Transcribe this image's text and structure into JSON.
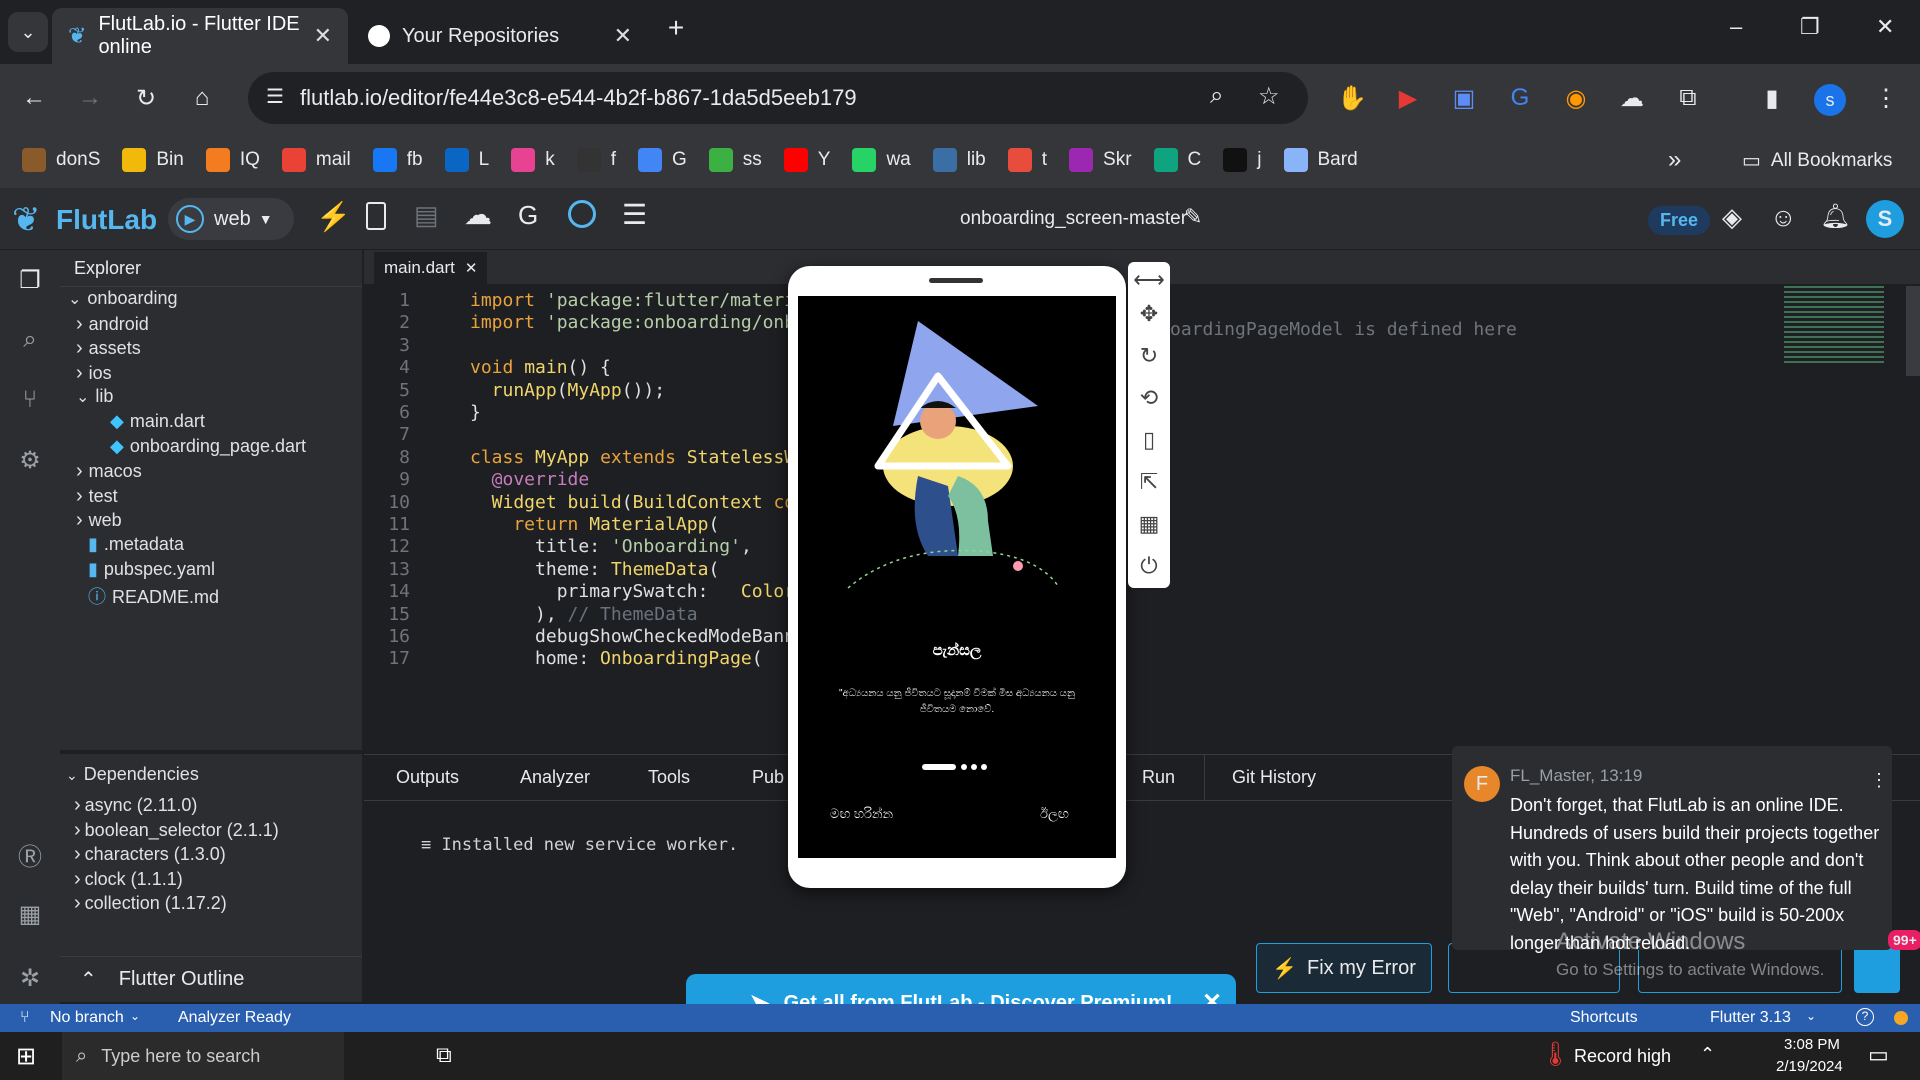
{
  "browser": {
    "tabs": [
      {
        "title": "FlutLab.io - Flutter IDE online",
        "active": true
      },
      {
        "title": "Your Repositories",
        "active": false
      }
    ],
    "new_tab": "+",
    "url": "flutlab.io/editor/fe44e3c8-e544-4b2f-b867-1da5d5eeb179",
    "profile_initial": "s",
    "window_controls": {
      "minimize": "–",
      "restore": "❐",
      "close": "✕"
    },
    "bookmarks": [
      {
        "label": "donS",
        "color": "#8b5a2b"
      },
      {
        "label": "Bin",
        "color": "#f0b90b"
      },
      {
        "label": "IQ",
        "color": "#f47c20"
      },
      {
        "label": "mail",
        "color": "#ea4335"
      },
      {
        "label": "fb",
        "color": "#1877f2"
      },
      {
        "label": "L",
        "color": "#0a66c2"
      },
      {
        "label": "k",
        "color": "#e84393"
      },
      {
        "label": "f",
        "color": "#333333"
      },
      {
        "label": "G",
        "color": "#4285f4"
      },
      {
        "label": "ss",
        "color": "#3cb043"
      },
      {
        "label": "Y",
        "color": "#ff0000"
      },
      {
        "label": "wa",
        "color": "#25d366"
      },
      {
        "label": "lib",
        "color": "#3b6ea5"
      },
      {
        "label": "t",
        "color": "#e84c3d"
      },
      {
        "label": "Skr",
        "color": "#9c27b0"
      },
      {
        "label": "C",
        "color": "#10a37f"
      },
      {
        "label": "j",
        "color": "#111111"
      },
      {
        "label": "Bard",
        "color": "#8ab4f8"
      }
    ],
    "more": "»",
    "all_bookmarks": "All Bookmarks"
  },
  "ide": {
    "logo": "FlutLab",
    "platform": "web",
    "project_name": "onboarding_screen-master",
    "plan_badge": "Free",
    "user_initial": "S",
    "explorer_title": "Explorer",
    "tree": [
      {
        "label": "onboarding",
        "type": "folder-open",
        "indent": 0
      },
      {
        "label": "android",
        "type": "folder",
        "indent": 1
      },
      {
        "label": "assets",
        "type": "folder",
        "indent": 1
      },
      {
        "label": "ios",
        "type": "folder",
        "indent": 1
      },
      {
        "label": "lib",
        "type": "folder-open",
        "indent": 1
      },
      {
        "label": "main.dart",
        "type": "dart",
        "indent": 2
      },
      {
        "label": "onboarding_page.dart",
        "type": "dart",
        "indent": 2
      },
      {
        "label": "macos",
        "type": "folder",
        "indent": 1
      },
      {
        "label": "test",
        "type": "folder",
        "indent": 1
      },
      {
        "label": "web",
        "type": "folder",
        "indent": 1
      },
      {
        "label": ".metadata",
        "type": "file",
        "indent": 1
      },
      {
        "label": "pubspec.yaml",
        "type": "file",
        "indent": 1
      },
      {
        "label": "README.md",
        "type": "info",
        "indent": 1
      }
    ],
    "dependencies_title": "Dependencies",
    "dependencies": [
      "async (2.11.0)",
      "boolean_selector (2.1.1)",
      "characters (1.3.0)",
      "clock (1.1.1)",
      "collection (1.17.2)"
    ],
    "flutter_outline": "Flutter Outline",
    "open_tab": "main.dart",
    "code_lines": [
      [
        {
          "t": "import ",
          "c": "kw"
        },
        {
          "t": "'package:flutter/materia",
          "c": "str"
        }
      ],
      [
        {
          "t": "import ",
          "c": "kw"
        },
        {
          "t": "'package:onboarding/onbo",
          "c": "str"
        }
      ],
      [],
      [
        {
          "t": "void ",
          "c": "kw"
        },
        {
          "t": "main",
          "c": "fn"
        },
        {
          "t": "() {",
          "c": "p"
        }
      ],
      [
        {
          "t": "  runApp",
          "c": "fn"
        },
        {
          "t": "(",
          "c": "p"
        },
        {
          "t": "MyApp",
          "c": "cls"
        },
        {
          "t": "());",
          "c": "p"
        }
      ],
      [
        {
          "t": "}",
          "c": "p"
        }
      ],
      [],
      [
        {
          "t": "class ",
          "c": "kw"
        },
        {
          "t": "MyApp ",
          "c": "cls"
        },
        {
          "t": "extends ",
          "c": "kw"
        },
        {
          "t": "StatelessWi",
          "c": "cls"
        }
      ],
      [
        {
          "t": "  @override",
          "c": "ann"
        }
      ],
      [
        {
          "t": "  Widget ",
          "c": "cls"
        },
        {
          "t": "build",
          "c": "fn"
        },
        {
          "t": "(",
          "c": "p"
        },
        {
          "t": "BuildContext ",
          "c": "cls"
        },
        {
          "t": "con",
          "c": "kw"
        }
      ],
      [
        {
          "t": "    return ",
          "c": "kw"
        },
        {
          "t": "MaterialApp",
          "c": "cls"
        },
        {
          "t": "(",
          "c": "p"
        }
      ],
      [
        {
          "t": "      title: ",
          "c": "p"
        },
        {
          "t": "'Onboarding'",
          "c": "str"
        },
        {
          "t": ",",
          "c": "p"
        }
      ],
      [
        {
          "t": "      theme: ",
          "c": "p"
        },
        {
          "t": "ThemeData",
          "c": "cls"
        },
        {
          "t": "(",
          "c": "p"
        }
      ],
      [
        {
          "t": "        primarySwatch: ",
          "c": "p"
        },
        {
          "t": "  Color",
          "c": "cls"
        }
      ],
      [
        {
          "t": "      ), ",
          "c": "p"
        },
        {
          "t": "// ThemeData",
          "c": "cmt"
        }
      ],
      [
        {
          "t": "      debugShowCheckedModeBanne",
          "c": "p"
        }
      ],
      [
        {
          "t": "      home: ",
          "c": "p"
        },
        {
          "t": "OnboardingPage",
          "c": "cls"
        },
        {
          "t": "(",
          "c": "p"
        }
      ]
    ],
    "code_comment_right": "oardingPageModel is defined here",
    "panel_tabs": [
      "Outputs",
      "Analyzer",
      "Tools",
      "Pub",
      "Run",
      "Git History"
    ],
    "console_output": "Installed new service worker.",
    "status": {
      "branch": "No branch",
      "analyzer": "Analyzer Ready",
      "shortcuts": "Shortcuts",
      "flutter_version": "Flutter 3.13"
    },
    "fix_error": "Fix my Error",
    "premium_banner": "Get all from FlutLab - Discover Premium!",
    "chat": {
      "author_initial": "F",
      "author": "FL_Master, 13:19",
      "message": "Don't forget, that FlutLab is an online IDE. Hundreds of users build their projects together with you. Think about other people and don't delay their builds' turn. Build time of the full \"Web\", \"Android\" or \"iOS\" build is 50-200x longer than hot reload.",
      "badge": "99+"
    },
    "watermark": [
      "Activate Windows",
      "Go to Settings to activate Windows."
    ]
  },
  "phone_app": {
    "heading": "පැන්සල",
    "body": "\"අධ්‍යයනය යනු ජීවිතයට සූදානම් වීමක් මිස අධ්‍යයනය යනු ජීවිතයම නොවේ.",
    "skip": "මඟ හරින්න",
    "next": "ඊලඟ",
    "page_index": 1,
    "page_count": 4
  },
  "taskbar": {
    "search_placeholder": "Type here to search",
    "weather": "Record high",
    "time": "3:08 PM",
    "date": "2/19/2024"
  },
  "colors": {
    "accent": "#1e9ddf",
    "statusbar": "#2a5fb0",
    "kw": "#e8a33d",
    "str": "#b5cea8"
  }
}
